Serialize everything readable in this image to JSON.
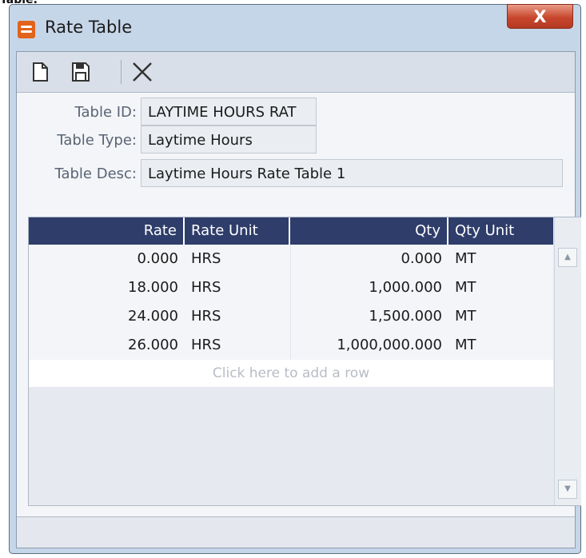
{
  "page_label": "Table:",
  "window": {
    "title": "Rate Table",
    "close_label": "X"
  },
  "toolbar": {
    "buttons": [
      {
        "name": "new",
        "icon": "new-document-icon"
      },
      {
        "name": "save",
        "icon": "save-icon"
      },
      {
        "name": "delete",
        "icon": "delete-x-icon"
      }
    ]
  },
  "form": {
    "table_id_label": "Table ID:",
    "table_id_value": "LAYTIME HOURS RAT",
    "table_type_label": "Table Type:",
    "table_type_value": "Laytime Hours",
    "table_desc_label": "Table Desc:",
    "table_desc_value": "Laytime Hours Rate Table 1"
  },
  "grid": {
    "columns": [
      "Rate",
      "Rate Unit",
      "Qty",
      "Qty Unit"
    ],
    "rows": [
      {
        "rate": "0.000",
        "rate_unit": "HRS",
        "qty": "0.000",
        "qty_unit": "MT"
      },
      {
        "rate": "18.000",
        "rate_unit": "HRS",
        "qty": "1,000.000",
        "qty_unit": "MT"
      },
      {
        "rate": "24.000",
        "rate_unit": "HRS",
        "qty": "1,500.000",
        "qty_unit": "MT"
      },
      {
        "rate": "26.000",
        "rate_unit": "HRS",
        "qty": "1,000,000.000",
        "qty_unit": "MT"
      }
    ],
    "add_row_text": "Click here to add a row"
  },
  "colors": {
    "header_bg": "#2e3d6a",
    "window_frame": "#c6d6e9",
    "close_button": "#c7472d"
  }
}
